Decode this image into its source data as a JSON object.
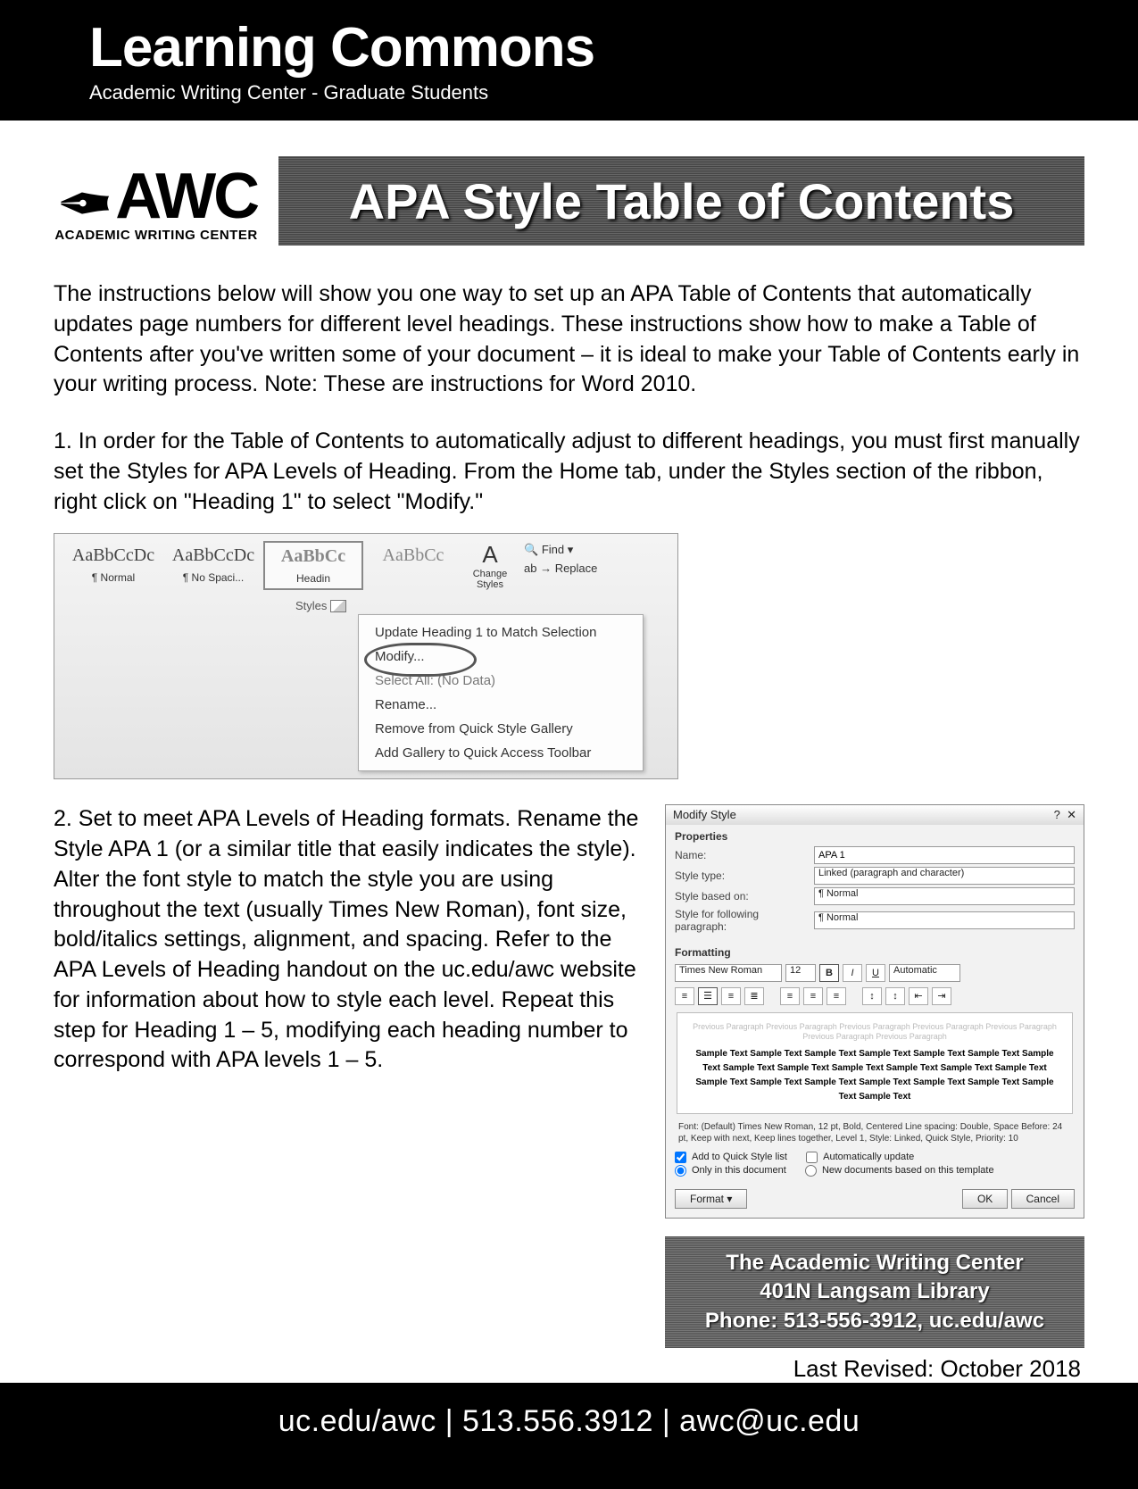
{
  "header": {
    "title": "Learning Commons",
    "subtitle": "Academic Writing Center - Graduate Students"
  },
  "logo": {
    "abbr": "AWC",
    "tag": "ACADEMIC WRITING CENTER"
  },
  "banner_title": "APA Style Table of Contents",
  "intro": "The instructions below will show you one way to set up an APA Table of Contents that automatically updates page numbers for different level headings. These instructions show how to make a Table of Contents after you've written some of your document – it is ideal to make your Table of Contents early in your writing process. Note: These are instructions for Word 2010.",
  "step1": "1. In order for the Table of Contents to automatically adjust to different headings, you must first manually set the Styles for APA Levels of Heading. From the Home tab, under the Styles section of the ribbon, right click on \"Heading 1\" to select \"Modify.\"",
  "ribbon": {
    "styles": [
      {
        "preview": "AaBbCcDc",
        "name": "¶ Normal"
      },
      {
        "preview": "AaBbCcDc",
        "name": "¶ No Spaci..."
      },
      {
        "preview": "AaBbCc",
        "name": "Headin"
      },
      {
        "preview": "AaBbCc",
        "name": ""
      }
    ],
    "change_styles": "Change Styles",
    "styles_label": "Styles",
    "editing": {
      "find": "Find ▾",
      "replace": "Replace"
    },
    "context_menu": [
      "Update Heading 1 to Match Selection",
      "Modify...",
      "Select All: (No Data)",
      "Rename...",
      "Remove from Quick Style Gallery",
      "Add Gallery to Quick Access Toolbar"
    ]
  },
  "step2": "2. Set to meet APA Levels of Heading formats. Rename the Style APA 1 (or a similar title that easily indicates the style). Alter the font style to match the style you are using throughout the text (usually Times New Roman), font size, bold/italics settings, alignment, and spacing. Refer to the APA Levels of Heading handout on the uc.edu/awc website for information about how to style each level. Repeat this step for Heading 1 – 5, modifying each heading number to correspond with APA levels 1 – 5.",
  "dialog": {
    "title": "Modify Style",
    "properties_h": "Properties",
    "name_label": "Name:",
    "name_value": "APA 1",
    "type_label": "Style type:",
    "type_value": "Linked (paragraph and character)",
    "based_label": "Style based on:",
    "based_value": "¶ Normal",
    "following_label": "Style for following paragraph:",
    "following_value": "¶ Normal",
    "formatting_h": "Formatting",
    "font": "Times New Roman",
    "size": "12",
    "color": "Automatic",
    "preview_lines": [
      "Sample Text Sample Text Sample Text Sample Text Sample Text Sample Text Sample",
      "Text Sample Text Sample Text Sample Text Sample Text Sample Text Sample Text",
      "Sample Text Sample Text Sample Text Sample Text Sample Text Sample Text Sample",
      "Text Sample Text"
    ],
    "desc": "Font: (Default) Times New Roman, 12 pt, Bold, Centered\n    Line spacing:  Double, Space\n    Before:  24 pt, Keep with next, Keep lines together, Level 1, Style: Linked, Quick Style, Priority:\n10",
    "add_quick": "Add to Quick Style list",
    "auto_update": "Automatically update",
    "only_doc": "Only in this document",
    "new_tmpl": "New documents based on this template",
    "format_btn": "Format ▾",
    "ok": "OK",
    "cancel": "Cancel"
  },
  "contact": {
    "line1": "The Academic Writing Center",
    "line2": "401N Langsam Library",
    "line3": "Phone: 513-556-3912,  uc.edu/awc"
  },
  "revised": "Last Revised: October 2018",
  "footer": "uc.edu/awc  |  513.556.3912  | awc@uc.edu"
}
